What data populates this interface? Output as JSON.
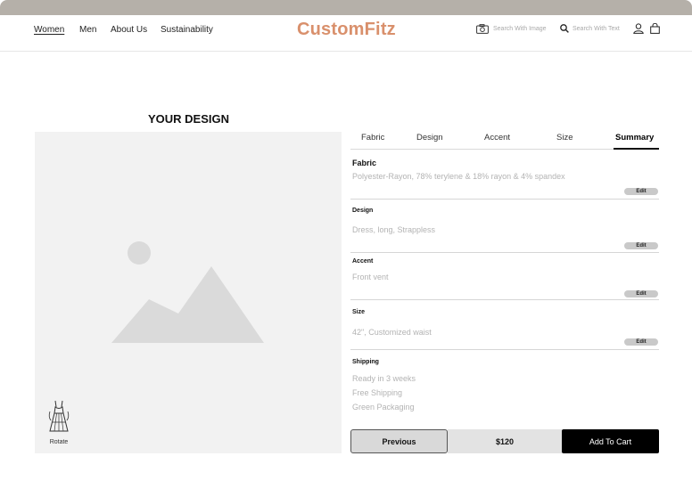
{
  "nav": {
    "links": [
      "Women",
      "Men",
      "About Us",
      "Sustainability"
    ],
    "active": "Women",
    "logo": "CustomFitz",
    "search_image_label": "Search With Image",
    "search_text_label": "Search With Text",
    "icons": [
      "camera-icon",
      "search-icon",
      "user-icon",
      "shopping-bag-icon"
    ],
    "logo_color": "#d9906c"
  },
  "design_panel": {
    "title": "YOUR DESIGN",
    "rotate_label": "Rotate",
    "icons": [
      "image-placeholder-icon",
      "dress-rotate-icon"
    ]
  },
  "tabs": {
    "items": [
      "Fabric",
      "Design",
      "Accent",
      "Size",
      "Summary"
    ],
    "active": "Summary"
  },
  "summary": {
    "fabric": {
      "title": "Fabric",
      "value": "Polyester-Rayon, 78% terylene & 18% rayon & 4% spandex",
      "edit": "Edit"
    },
    "design": {
      "title": "Design",
      "value": "Dress, long, Strappless",
      "edit": "Edit"
    },
    "accent": {
      "title": "Accent",
      "value": "Front vent",
      "edit": "Edit"
    },
    "size": {
      "title": "Size",
      "value": "42\", Customized waist",
      "edit": "Edit"
    },
    "shipping": {
      "title": "Shipping",
      "lines": [
        "Ready in 3 weeks",
        "Free Shipping",
        "Green Packaging"
      ]
    }
  },
  "footer": {
    "previous": "Previous",
    "price": "$120",
    "add_to_cart": "Add To Cart"
  }
}
